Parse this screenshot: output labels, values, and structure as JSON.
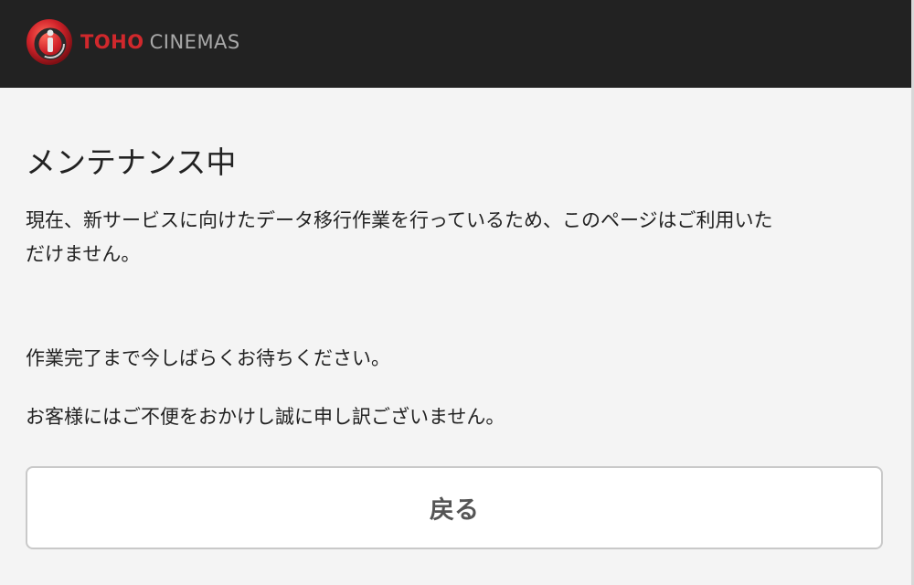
{
  "header": {
    "logo_word_1": "TOHO",
    "logo_word_2": "CINEMAS",
    "logo_icon": "toho-cinemas-logo-icon",
    "background_color": "#222222",
    "brand_red": "#d0282c"
  },
  "main": {
    "title": "メンテナンス中",
    "paragraph_1_line_1": "現在、新サービスに向けたデータ移行作業を行っているため、このページはご利用いた",
    "paragraph_1_line_2": "だけません。",
    "paragraph_2": "作業完了まで今しばらくお待ちください。",
    "paragraph_3": "お客様にはご不便をおかけし誠に申し訳ございません。"
  },
  "actions": {
    "back_label": "戻る"
  }
}
